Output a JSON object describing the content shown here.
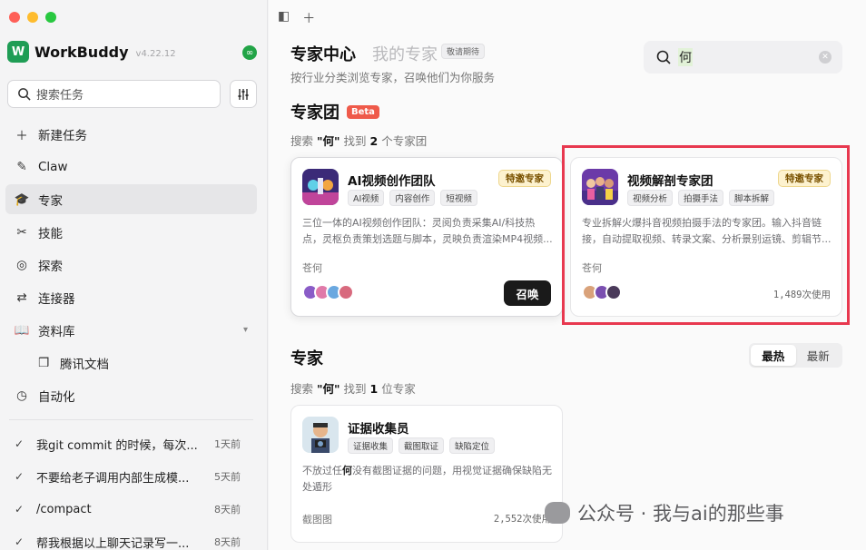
{
  "app": {
    "name": "WorkBuddy",
    "version": "v4.22.12"
  },
  "sidebar": {
    "search_placeholder": "搜索任务",
    "nav": [
      {
        "label": "新建任务",
        "icon": "plus-icon"
      },
      {
        "label": "Claw",
        "icon": "claw-icon"
      },
      {
        "label": "专家",
        "icon": "graduation-cap-icon",
        "active": true
      },
      {
        "label": "技能",
        "icon": "tools-icon"
      },
      {
        "label": "探索",
        "icon": "compass-icon"
      },
      {
        "label": "连接器",
        "icon": "connector-icon"
      },
      {
        "label": "资料库",
        "icon": "book-icon"
      },
      {
        "label": "腾讯文档",
        "icon": "doc-icon"
      },
      {
        "label": "自动化",
        "icon": "clock-icon"
      }
    ],
    "history": [
      {
        "title": "我git commit 的时候，每次...",
        "time": "1天前"
      },
      {
        "title": "不要给老子调用内部生成模...",
        "time": "5天前"
      },
      {
        "title": "/compact",
        "time": "8天前"
      },
      {
        "title": "帮我根据以上聊天记录写一...",
        "time": "8天前"
      }
    ]
  },
  "main": {
    "tab_active": "专家中心",
    "tab_inactive": "我的专家",
    "coming_soon": "敬请期待",
    "subtitle": "按行业分类浏览专家，召唤他们为你服务",
    "search_value": "何",
    "team_section": {
      "title": "专家团",
      "beta": "Beta",
      "found_prefix": "搜索",
      "query": "\"何\"",
      "found_mid": "找到",
      "count": "2",
      "found_suffix": "个专家团"
    },
    "team_cards": [
      {
        "name": "AI视频创作团队",
        "badge": "特邀专家",
        "tags": [
          "AI视频",
          "内容创作",
          "短视频"
        ],
        "desc": "三位一体的AI视频创作团队：灵阅负责采集AI/科技热点，灵枢负责策划选题与脚本，灵映负责渲染MP4视频...",
        "author": "苍何",
        "action": "召唤"
      },
      {
        "name": "视频解剖专家团",
        "badge": "特邀专家",
        "tags": [
          "视频分析",
          "拍摄手法",
          "脚本拆解"
        ],
        "desc": "专业拆解火爆抖音视频拍摄手法的专家团。输入抖音链接，自动提取视频、转录文案、分析景别运镜、剪辑节...",
        "author": "苍何",
        "uses": "1,489次使用"
      }
    ],
    "expert_section": {
      "title": "专家",
      "found_prefix": "搜索",
      "query": "\"何\"",
      "found_mid": "找到",
      "count": "1",
      "found_suffix": "位专家",
      "sort_hot": "最热",
      "sort_new": "最新"
    },
    "expert_cards": [
      {
        "name": "证据收集员",
        "tags": [
          "证据收集",
          "截图取证",
          "缺陷定位"
        ],
        "desc_before": "不放过任",
        "desc_highlight": "何",
        "desc_after": "没有截图证据的问题，用视觉证据确保缺陷无处遁形",
        "author": "截图图",
        "uses": "2,552次使用"
      }
    ],
    "watermark": "公众号 · 我与ai的那些事"
  },
  "colors": {
    "accent_green": "#1f9d55",
    "beta": "#ef5a4a",
    "highlight_box": "#e8384f",
    "badge_bg": "#fdf2cf"
  }
}
